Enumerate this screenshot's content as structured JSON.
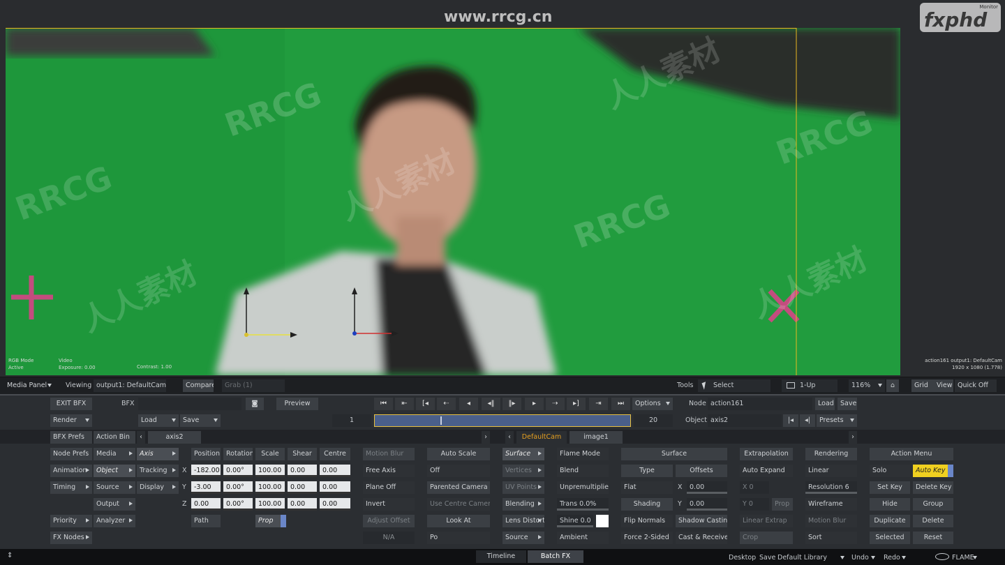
{
  "watermarks": {
    "site": "www.rrcg.cn",
    "brand": "fxphd",
    "brand_badge": "Monitor",
    "repeat": "RRCG",
    "cn": "人人素材"
  },
  "viewer": {
    "overlay_left": [
      "RGB Mode",
      "Active"
    ],
    "overlay_mid": [
      "Video",
      "Exposure: 0.00"
    ],
    "overlay_contrast": "Contrast: 1.00",
    "overlay_right": [
      "action161 output1: DefaultCam",
      "1920 x 1080 (1.778)"
    ]
  },
  "viewbar": {
    "media_panel": "Media Panel",
    "viewing_label": "Viewing",
    "viewing_value": "output1: DefaultCam",
    "compare": "Compare",
    "grab": "Grab (1)",
    "tools_label": "Tools",
    "select": "Select",
    "layout": "1-Up",
    "zoom": "116%",
    "grid": "Grid",
    "view": "View",
    "quick": "Quick Off"
  },
  "top": {
    "exit": "EXIT BFX",
    "bfx_label": "BFX",
    "preview": "Preview",
    "render": "Render",
    "load": "Load",
    "save": "Save",
    "frame_start": "1",
    "frame_end": "20",
    "options": "Options",
    "node_label": "Node",
    "node_value": "action161",
    "node_load": "Load",
    "node_save": "Save",
    "object_label": "Object",
    "object_value": "axis2",
    "presets": "Presets"
  },
  "tabs": {
    "left": "axis2",
    "cam": "DefaultCam",
    "image": "image1"
  },
  "left": {
    "bfx_prefs": "BFX Prefs",
    "action_bin": "Action Bin",
    "node_prefs": "Node Prefs",
    "media": "Media",
    "animation": "Animation",
    "object": "Object",
    "timing": "Timing",
    "source": "Source",
    "output": "Output",
    "priority": "Priority",
    "analyzer": "Analyzer",
    "fx_nodes": "FX Nodes",
    "axis": "Axis",
    "tracking": "Tracking",
    "display": "Display"
  },
  "axis": {
    "headers": [
      "Position",
      "Rotation",
      "Scale",
      "Shear",
      "Centre"
    ],
    "axes": [
      "X",
      "Y",
      "Z"
    ],
    "rows": [
      [
        "-182.00",
        "0.00°",
        "100.00",
        "0.00",
        "0.00"
      ],
      [
        "-3.00",
        "0.00°",
        "100.00",
        "0.00",
        "0.00"
      ],
      [
        "0.00",
        "0.00°",
        "100.00",
        "0.00",
        "0.00"
      ]
    ],
    "path": "Path",
    "prop": "Prop"
  },
  "col_mb": {
    "motion_blur": "Motion Blur",
    "free_axis": "Free Axis",
    "plane_off": "Plane Off",
    "invert": "Invert",
    "adjust_offset": "Adjust Offset",
    "na": "N/A"
  },
  "col_scale": {
    "auto_scale": "Auto Scale",
    "off": "Off",
    "parented_camera": "Parented Camera",
    "use_centre_camera": "Use Centre Camera",
    "look_at": "Look At",
    "pos": "Po"
  },
  "col_surface": {
    "surface": "Surface",
    "vertices": "Vertices",
    "uv_points": "UV Points",
    "blending": "Blending",
    "lens_distort": "Lens Distort",
    "source": "Source"
  },
  "col_flame": {
    "flame_mode": "Flame Mode",
    "blend": "Blend",
    "unpremultiplied": "Unpremultiplied",
    "trans": "Trans 0.0%",
    "shine": "Shine 0.0",
    "ambient": "Ambient"
  },
  "col_surface2": {
    "header": "Surface",
    "type": "Type",
    "flat": "Flat",
    "shading": "Shading",
    "flip_normals": "Flip Normals",
    "force_2sided": "Force 2-Sided",
    "offsets": "Offsets",
    "offx": "0.00",
    "offy": "0.00",
    "shadow_casting": "Shadow Casting",
    "cast_receive": "Cast & Receive",
    "x": "X",
    "y": "Y"
  },
  "col_extrap": {
    "header": "Extrapolation",
    "auto_expand": "Auto Expand",
    "x0": "X 0",
    "y0": "Y 0",
    "prop": "Prop",
    "linear_extrap": "Linear Extrap",
    "crop": "Crop"
  },
  "col_render": {
    "header": "Rendering",
    "linear": "Linear",
    "resolution": "Resolution 6",
    "wireframe": "Wireframe",
    "motion_blur": "Motion Blur",
    "sort": "Sort"
  },
  "col_action": {
    "header": "Action Menu",
    "solo": "Solo",
    "auto_key": "Auto Key",
    "set_key": "Set Key",
    "delete_key": "Delete Key",
    "hide": "Hide",
    "group": "Group",
    "duplicate": "Duplicate",
    "delete": "Delete",
    "selected": "Selected",
    "reset": "Reset"
  },
  "status": {
    "timeline": "Timeline",
    "batch_fx": "Batch FX",
    "desktop": "Desktop",
    "save": "Save",
    "library": "Default Library",
    "undo": "Undo",
    "redo": "Redo",
    "flame": "FLAME"
  },
  "colors": {
    "greenscreen": "#1f9a3c",
    "accent_yellow": "#f0d020",
    "accent_orange": "#e6a020",
    "panel": "#2b2e32",
    "button": "#3b3f44"
  }
}
